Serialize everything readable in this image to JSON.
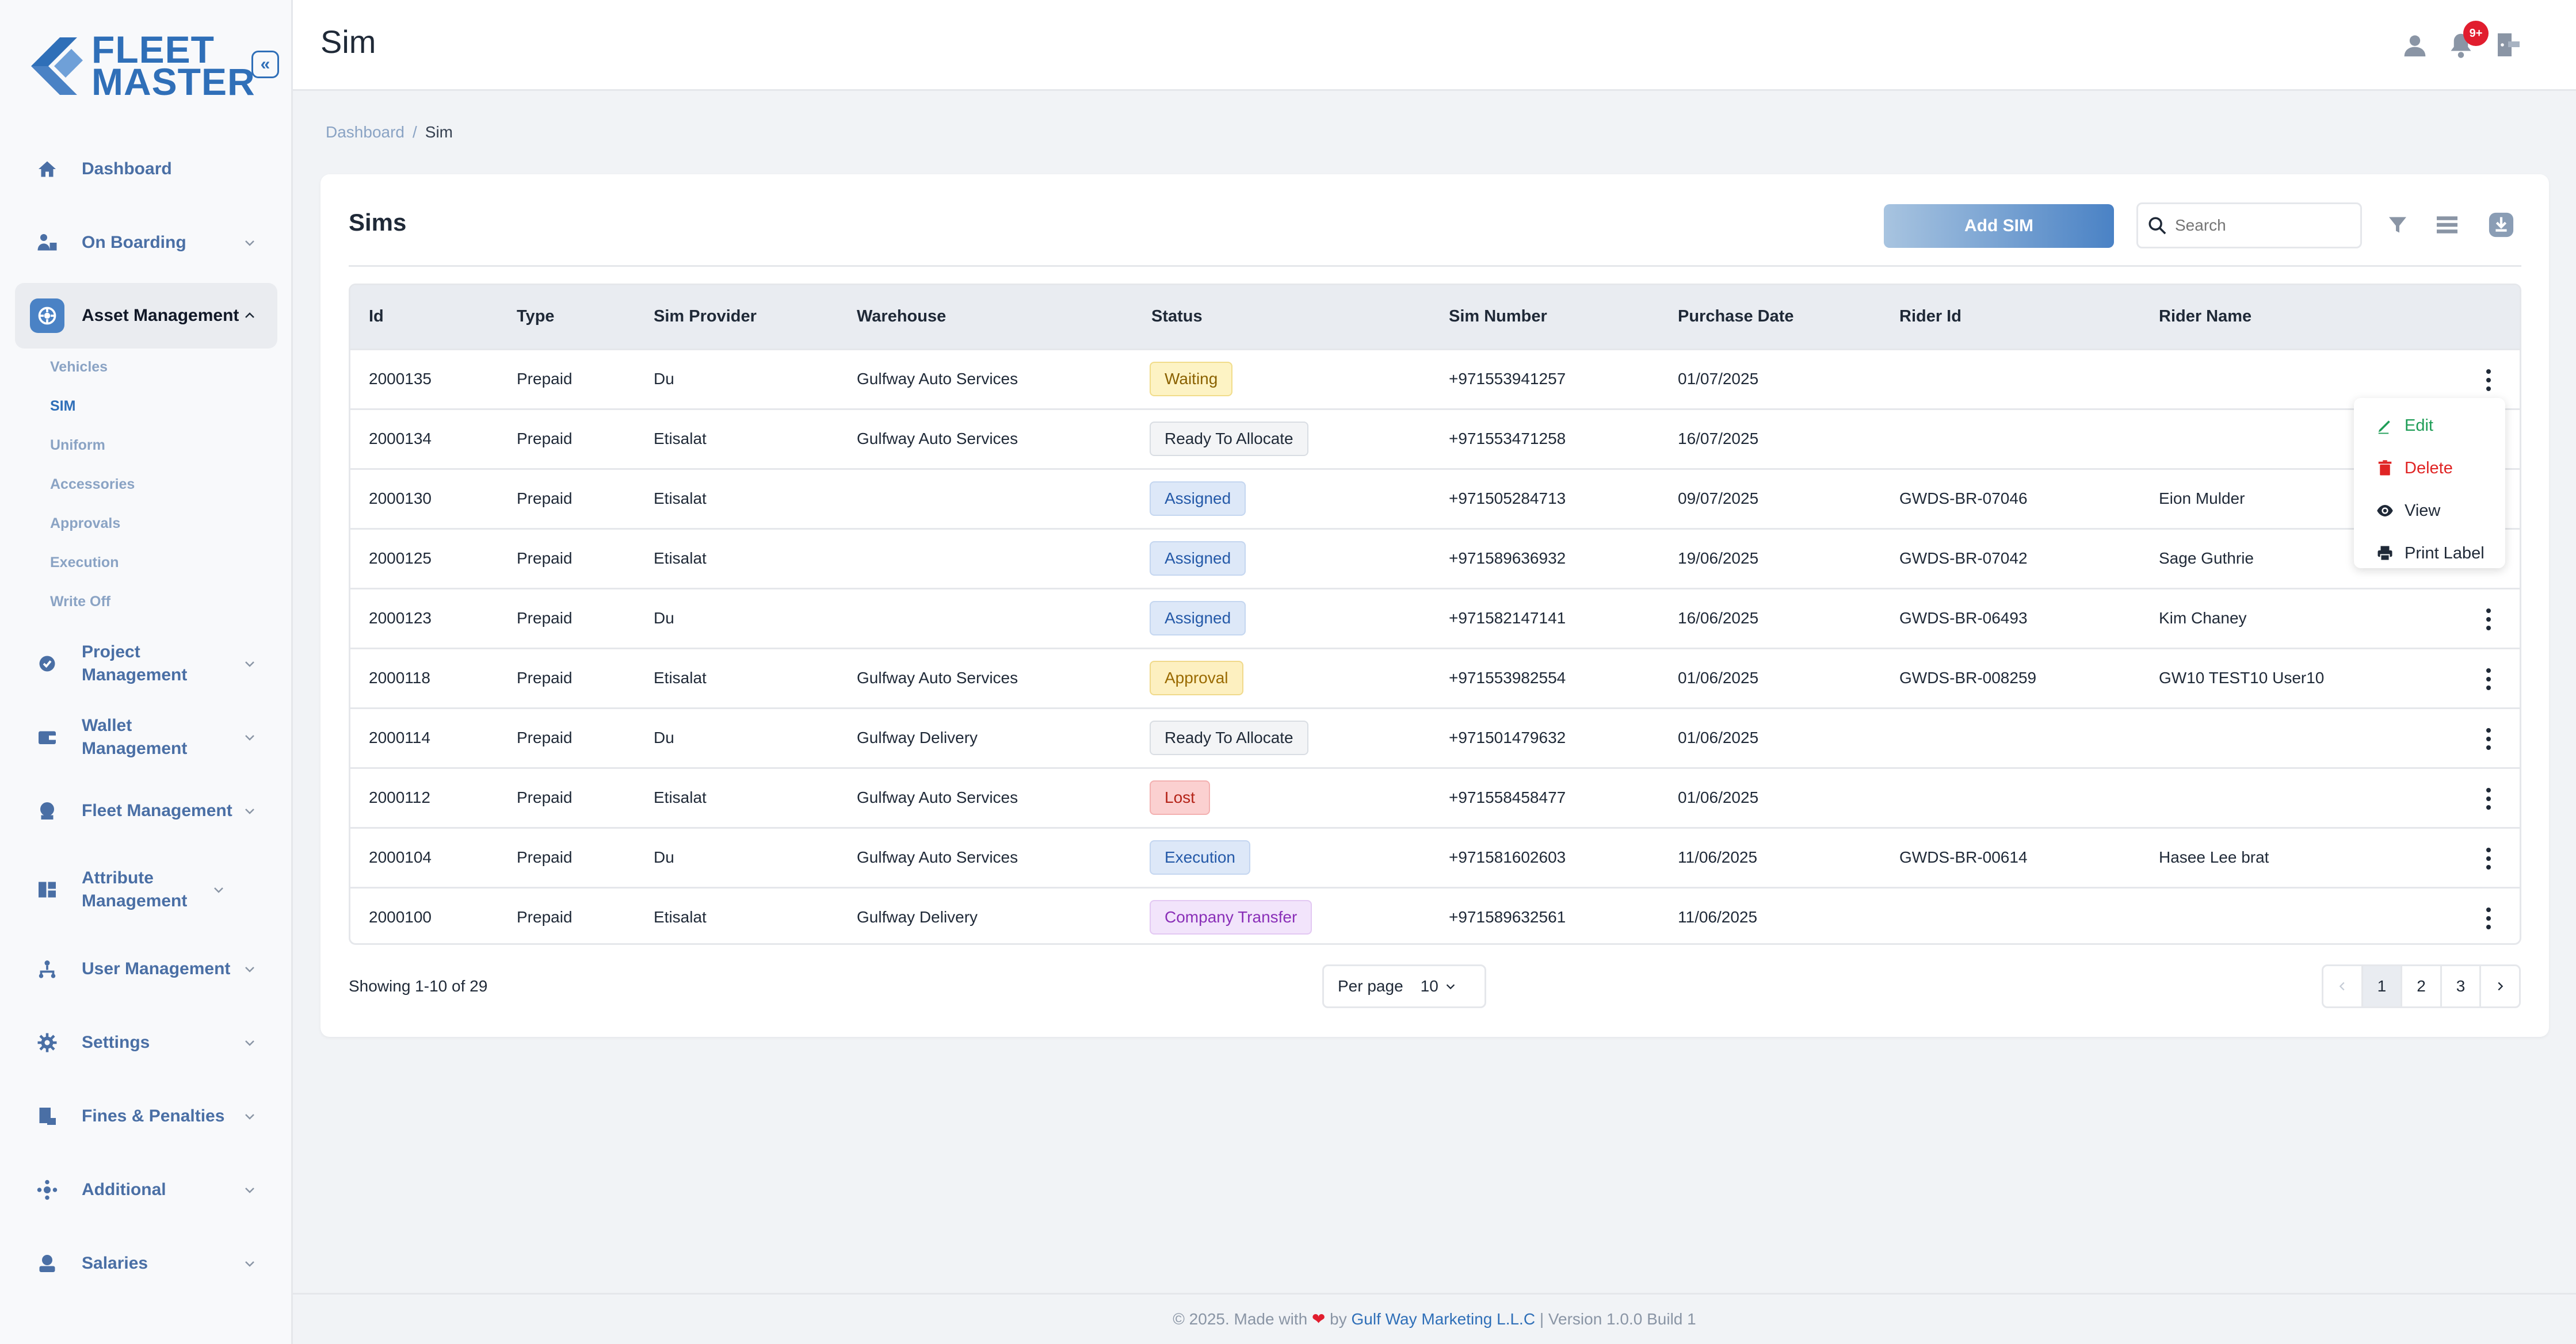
{
  "brand": {
    "line1": "FLEET",
    "line2": "MASTER"
  },
  "sidebar": {
    "items": [
      {
        "label": "Dashboard",
        "icon": "home-icon",
        "has_chevron": false
      },
      {
        "label": "On Boarding",
        "icon": "onboarding-icon",
        "has_chevron": true
      },
      {
        "label": "Asset Management",
        "icon": "asset-icon",
        "has_chevron": true,
        "active": true
      },
      {
        "label": "Project Management",
        "icon": "project-icon",
        "has_chevron": true
      },
      {
        "label": "Wallet Management",
        "icon": "wallet-icon",
        "has_chevron": true
      },
      {
        "label": "Fleet Management",
        "icon": "fleet-icon",
        "has_chevron": true
      },
      {
        "label": "Attribute Management",
        "icon": "attribute-icon",
        "has_chevron": true
      },
      {
        "label": "User Management",
        "icon": "users-icon",
        "has_chevron": true
      },
      {
        "label": "Settings",
        "icon": "gear-icon",
        "has_chevron": true
      },
      {
        "label": "Fines & Penalties",
        "icon": "fines-icon",
        "has_chevron": true
      },
      {
        "label": "Additional",
        "icon": "additional-icon",
        "has_chevron": true
      },
      {
        "label": "Salaries",
        "icon": "salaries-icon",
        "has_chevron": true
      }
    ],
    "sub_items": [
      {
        "label": "Vehicles"
      },
      {
        "label": "SIM",
        "active": true
      },
      {
        "label": "Uniform"
      },
      {
        "label": "Accessories"
      },
      {
        "label": "Approvals"
      },
      {
        "label": "Execution"
      },
      {
        "label": "Write Off"
      }
    ]
  },
  "header": {
    "title": "Sim",
    "notification_count": "9+"
  },
  "breadcrumb": {
    "home": "Dashboard",
    "separator": "/",
    "current": "Sim"
  },
  "card": {
    "title": "Sims",
    "add_button": "Add SIM",
    "search_placeholder": "Search"
  },
  "table": {
    "columns": [
      "Id",
      "Type",
      "Sim Provider",
      "Warehouse",
      "Status",
      "Sim Number",
      "Purchase Date",
      "Rider Id",
      "Rider Name"
    ],
    "rows": [
      {
        "id": "2000135",
        "type": "Prepaid",
        "provider": "Du",
        "warehouse": "Gulfway Auto Services",
        "status": "Waiting",
        "sim_number": "+971553941257",
        "purchase_date": "01/07/2025",
        "rider_id": "",
        "rider_name": ""
      },
      {
        "id": "2000134",
        "type": "Prepaid",
        "provider": "Etisalat",
        "warehouse": "Gulfway Auto Services",
        "status": "Ready To Allocate",
        "sim_number": "+971553471258",
        "purchase_date": "16/07/2025",
        "rider_id": "",
        "rider_name": ""
      },
      {
        "id": "2000130",
        "type": "Prepaid",
        "provider": "Etisalat",
        "warehouse": "",
        "status": "Assigned",
        "sim_number": "+971505284713",
        "purchase_date": "09/07/2025",
        "rider_id": "GWDS-BR-07046",
        "rider_name": "Eion Mulder"
      },
      {
        "id": "2000125",
        "type": "Prepaid",
        "provider": "Etisalat",
        "warehouse": "",
        "status": "Assigned",
        "sim_number": "+971589636932",
        "purchase_date": "19/06/2025",
        "rider_id": "GWDS-BR-07042",
        "rider_name": "Sage Guthrie"
      },
      {
        "id": "2000123",
        "type": "Prepaid",
        "provider": "Du",
        "warehouse": "",
        "status": "Assigned",
        "sim_number": "+971582147141",
        "purchase_date": "16/06/2025",
        "rider_id": "GWDS-BR-06493",
        "rider_name": "Kim Chaney"
      },
      {
        "id": "2000118",
        "type": "Prepaid",
        "provider": "Etisalat",
        "warehouse": "Gulfway Auto Services",
        "status": "Approval",
        "sim_number": "+971553982554",
        "purchase_date": "01/06/2025",
        "rider_id": "GWDS-BR-008259",
        "rider_name": "GW10 TEST10 User10"
      },
      {
        "id": "2000114",
        "type": "Prepaid",
        "provider": "Du",
        "warehouse": "Gulfway Delivery",
        "status": "Ready To Allocate",
        "sim_number": "+971501479632",
        "purchase_date": "01/06/2025",
        "rider_id": "",
        "rider_name": ""
      },
      {
        "id": "2000112",
        "type": "Prepaid",
        "provider": "Etisalat",
        "warehouse": "Gulfway Auto Services",
        "status": "Lost",
        "sim_number": "+971558458477",
        "purchase_date": "01/06/2025",
        "rider_id": "",
        "rider_name": ""
      },
      {
        "id": "2000104",
        "type": "Prepaid",
        "provider": "Du",
        "warehouse": "Gulfway Auto Services",
        "status": "Execution",
        "sim_number": "+971581602603",
        "purchase_date": "11/06/2025",
        "rider_id": "GWDS-BR-00614",
        "rider_name": "Hasee Lee brat"
      },
      {
        "id": "2000100",
        "type": "Prepaid",
        "provider": "Etisalat",
        "warehouse": "Gulfway Delivery",
        "status": "Company Transfer",
        "sim_number": "+971589632561",
        "purchase_date": "11/06/2025",
        "rider_id": "",
        "rider_name": ""
      }
    ]
  },
  "status_colors": {
    "Waiting": {
      "bg": "#fdf3c4",
      "fg": "#8a6100",
      "border": "#f1dc8a"
    },
    "Ready To Allocate": {
      "bg": "#f3f4f6",
      "fg": "#1f2937",
      "border": "#d9dde3"
    },
    "Assigned": {
      "bg": "#dde8f8",
      "fg": "#2459a8",
      "border": "#c4d6f0"
    },
    "Approval": {
      "bg": "#fdf0c0",
      "fg": "#9a6a00",
      "border": "#f0d98a"
    },
    "Lost": {
      "bg": "#fbd0d0",
      "fg": "#b42318",
      "border": "#f3b0b0"
    },
    "Execution": {
      "bg": "#dde8f8",
      "fg": "#2459a8",
      "border": "#c4d6f0"
    },
    "Company Transfer": {
      "bg": "#f2e4fb",
      "fg": "#8a2fb8",
      "border": "#e3c8f3"
    }
  },
  "row_menu": {
    "items": [
      {
        "label": "Edit",
        "icon": "pencil-icon",
        "color": "#1f9d57"
      },
      {
        "label": "Delete",
        "icon": "trash-icon",
        "color": "#e02424"
      },
      {
        "label": "View",
        "icon": "eye-icon",
        "color": "#1f2937"
      },
      {
        "label": "Print Label",
        "icon": "printer-icon",
        "color": "#1f2937"
      }
    ]
  },
  "pagination": {
    "showing": "Showing 1-10 of 29",
    "per_page_label": "Per page",
    "per_page_value": "10",
    "pages": [
      "1",
      "2",
      "3"
    ],
    "current_page": "1"
  },
  "footer": {
    "prefix": "© 2025. Made with",
    "by": "by",
    "company": "Gulf Way Marketing L.L.C",
    "version": "| Version 1.0.0 Build 1"
  },
  "accent_color": "#2f6fb8"
}
